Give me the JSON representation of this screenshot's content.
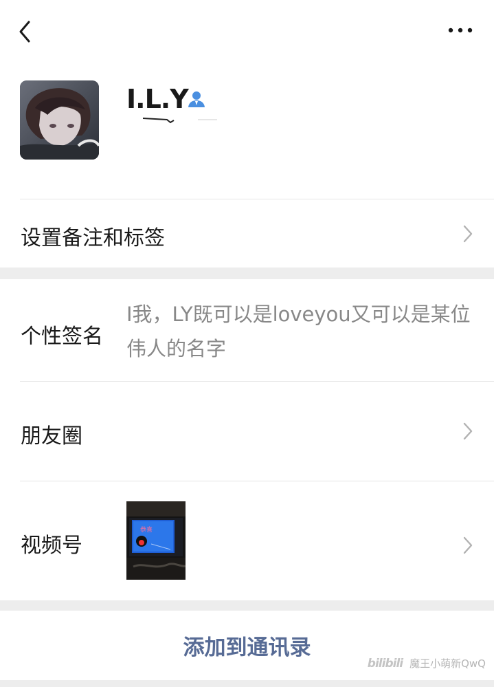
{
  "profile": {
    "name": "I.L.Y"
  },
  "rows": {
    "remark_label": "设置备注和标签",
    "signature_label": "个性签名",
    "signature_text": "I我，LY既可以是loveyou又可以是某位伟人的名字",
    "moments_label": "朋友圈",
    "channels_label": "视频号"
  },
  "actions": {
    "add_contact": "添加到通讯录"
  },
  "watermark": {
    "logo": "bilibili",
    "text": "魔王小萌新QwQ"
  },
  "colors": {
    "link_blue": "#576b95",
    "secondary_text": "#888888",
    "background": "#ededed"
  },
  "icons": [
    "back-icon",
    "more-icon",
    "contact-icon",
    "chevron-right-icon"
  ]
}
